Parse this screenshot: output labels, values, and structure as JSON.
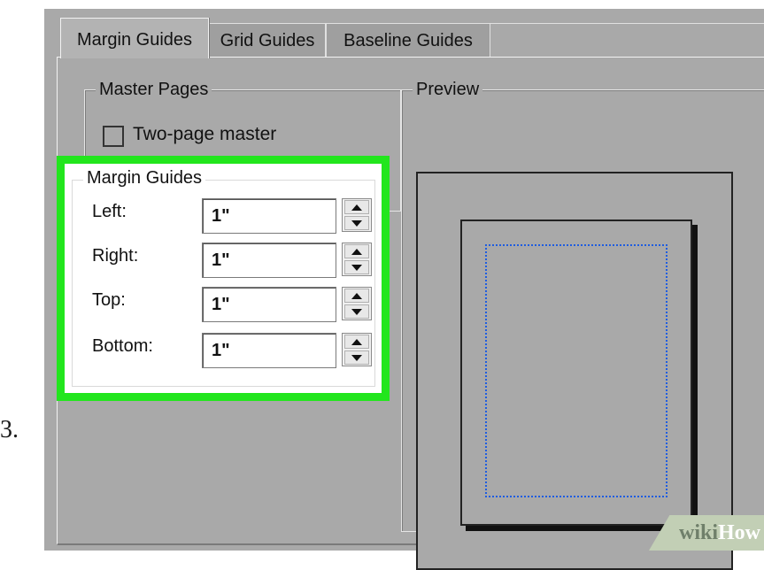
{
  "step_number": "3.",
  "tabs": [
    {
      "label": "Margin Guides",
      "active": true
    },
    {
      "label": "Grid Guides",
      "active": false
    },
    {
      "label": "Baseline Guides",
      "active": false
    }
  ],
  "master_pages": {
    "legend": "Master Pages",
    "two_page_master": {
      "label": "Two-page master",
      "checked": false
    }
  },
  "margin_guides": {
    "legend": "Margin Guides",
    "highlight_color": "#22e61d",
    "fields": [
      {
        "label": "Left:",
        "value": "1\""
      },
      {
        "label": "Right:",
        "value": "1\""
      },
      {
        "label": "Top:",
        "value": "1\""
      },
      {
        "label": "Bottom:",
        "value": "1\""
      }
    ]
  },
  "preview": {
    "legend": "Preview",
    "margin_line_color": "#1f5de0"
  },
  "watermark": {
    "part1": "wiki",
    "part2": "How"
  }
}
